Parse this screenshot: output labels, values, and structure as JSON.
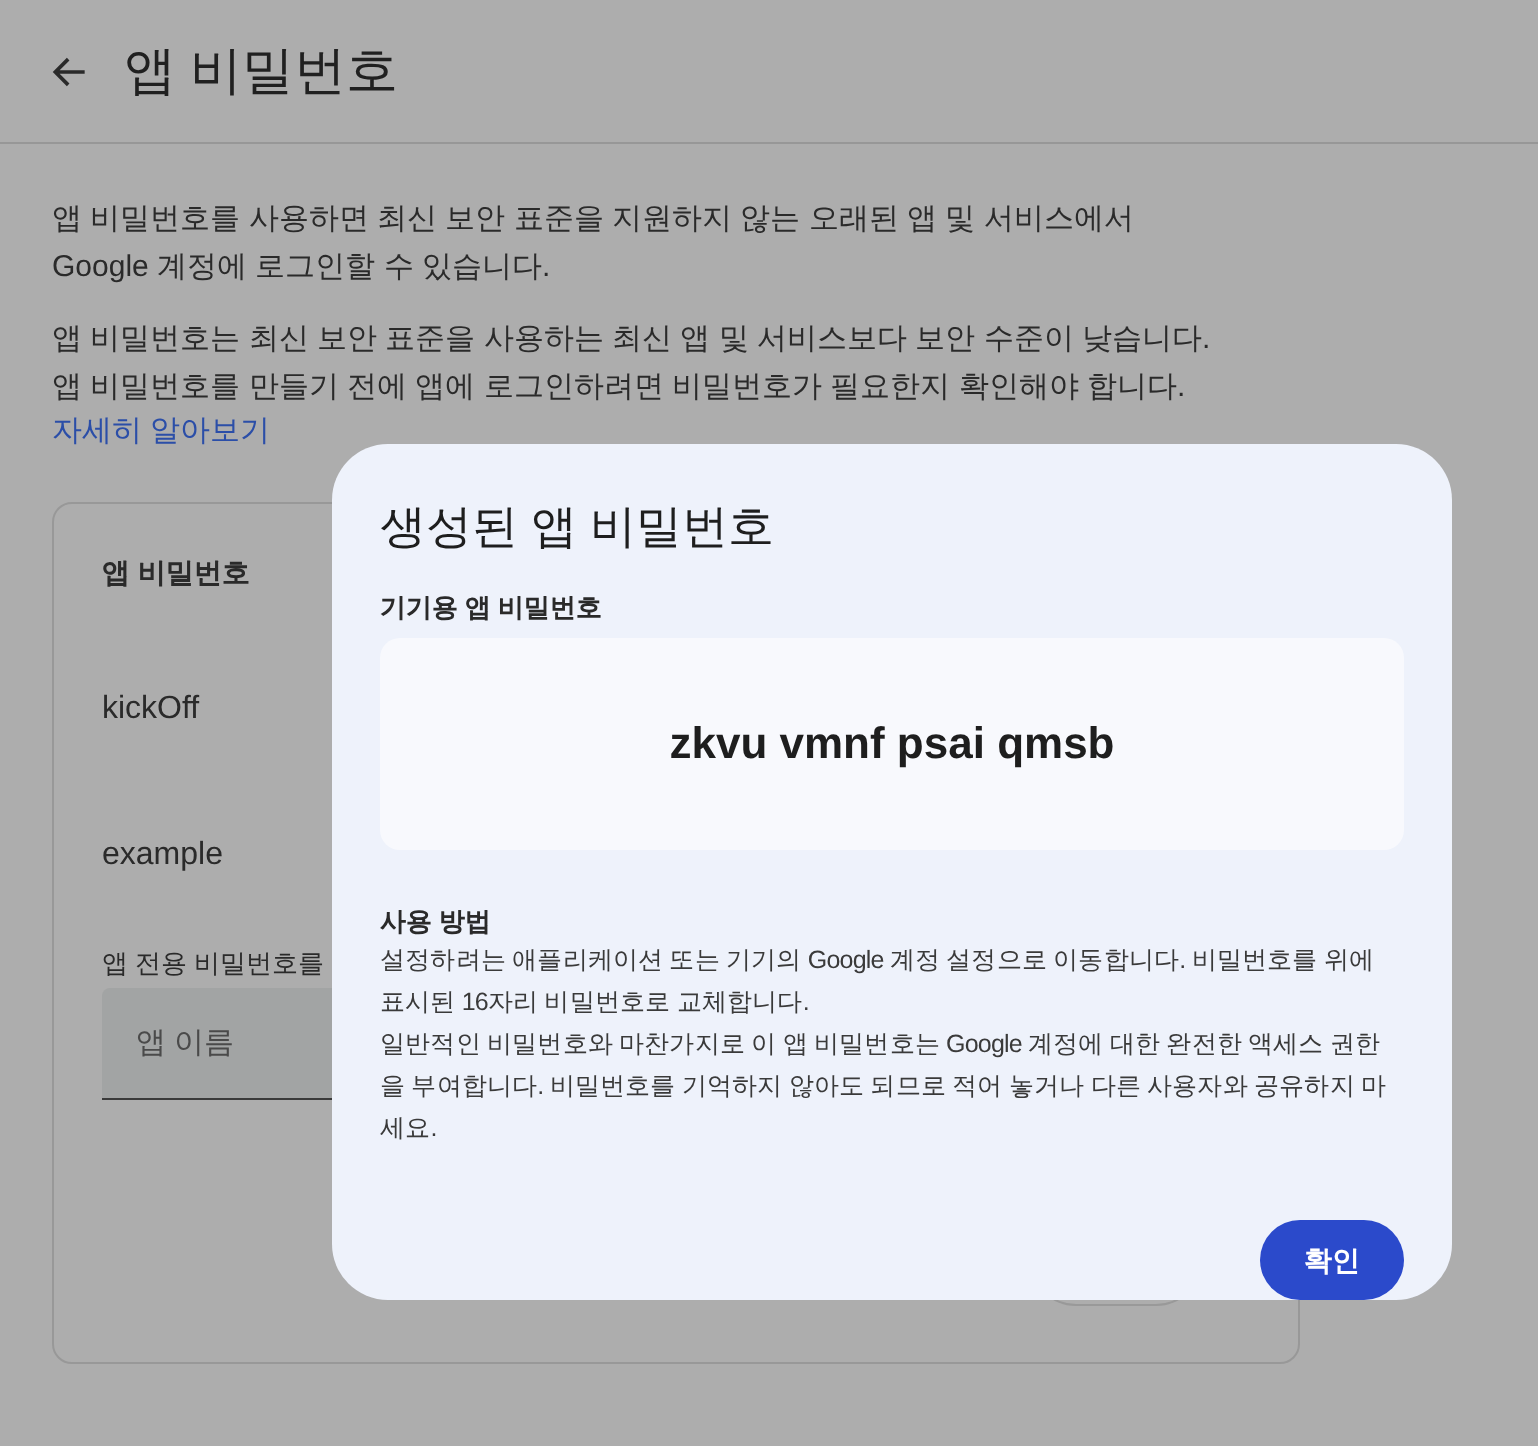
{
  "header": {
    "title": "앱 비밀번호"
  },
  "intro": [
    "앱 비밀번호를 사용하면 최신 보안 표준을 지원하지 않는 오래된 앱 및 서비스에서\nGoogle 계정에 로그인할 수 있습니다.",
    "앱 비밀번호는 최신 보안 표준을 사용하는 최신 앱 및 서비스보다 보안 수준이 낮습니다.\n앱 비밀번호를 만들기 전에 앱에 로그인하려면 비밀번호가 필요한지 확인해야 합니다."
  ],
  "learn_more_link": "자세히 알아보기",
  "card": {
    "title": "앱 비밀번호",
    "apps": [
      "kickOff",
      "example"
    ],
    "create_label": "앱 전용 비밀번호를",
    "name_field": {
      "placeholder": "앱 이름"
    }
  },
  "dialog": {
    "title": "생성된 앱 비밀번호",
    "password_label": "기기용 앱 비밀번호",
    "password": "zkvu vmnf psai qmsb",
    "howto_title": "사용 방법",
    "howto": [
      "설정하려는 애플리케이션 또는 기기의 Google 계정 설정으로 이동합니다. 비밀번호를 위에 표시된 16자리 비밀번호로 교체합니다.",
      "일반적인 비밀번호와 마찬가지로 이 앱 비밀번호는 Google 계정에 대한 완전한 액세스 권한을 부여합니다. 비밀번호를 기억하지 않아도 되므로 적어 놓거나 다른 사용자와 공유하지 마세요."
    ],
    "confirm_button": "확인"
  }
}
